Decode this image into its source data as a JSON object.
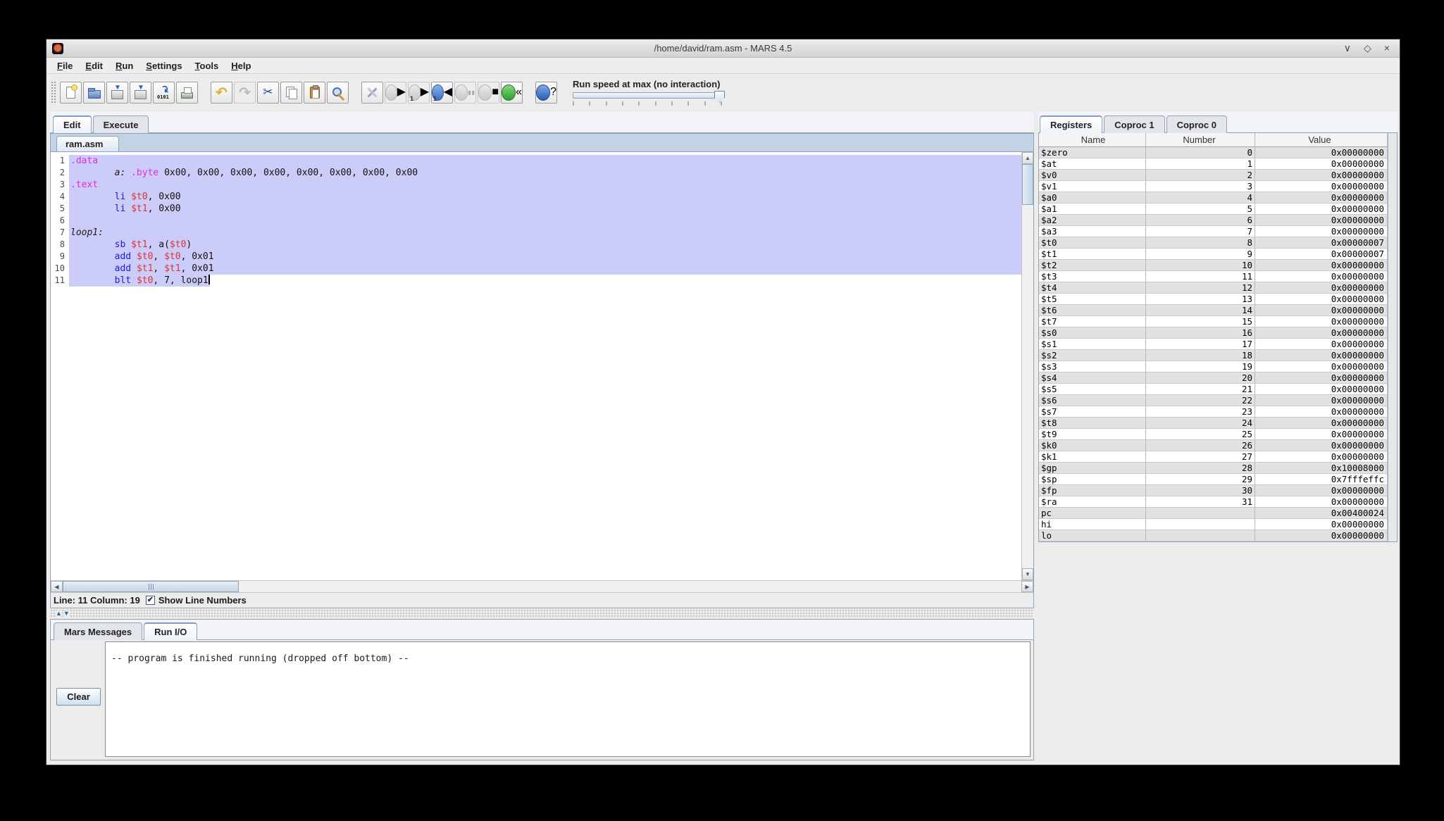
{
  "window": {
    "title": "/home/david/ram.asm - MARS 4.5",
    "controls": {
      "minimize": "∨",
      "maximize": "◇",
      "close": "×"
    }
  },
  "colors": {
    "selection": "#ccccf9",
    "directive": "#e02ce0",
    "instruction": "#1a1ae0",
    "register": "#dd3333"
  },
  "menu": {
    "items": [
      {
        "id": "file",
        "m": "F",
        "rest": "ile"
      },
      {
        "id": "edit",
        "m": "E",
        "rest": "dit"
      },
      {
        "id": "run",
        "m": "R",
        "rest": "un"
      },
      {
        "id": "settings",
        "m": "S",
        "rest": "ettings"
      },
      {
        "id": "tools",
        "m": "T",
        "rest": "ools"
      },
      {
        "id": "help",
        "m": "H",
        "rest": "elp"
      }
    ]
  },
  "toolbar": {
    "speed_label": "Run speed at max (no interaction)",
    "tick_count": 10,
    "buttons": [
      {
        "type": "grip",
        "name": "toolbar-grip"
      },
      {
        "type": "btn",
        "name": "new-file-button",
        "icon": "new-file-icon",
        "shape": "i-page i-new",
        "glyph": "",
        "enabled": true
      },
      {
        "type": "btn",
        "name": "open-file-button",
        "icon": "open-folder-icon",
        "shape": "i-folder",
        "glyph": "",
        "enabled": true
      },
      {
        "type": "btn",
        "name": "save-button",
        "icon": "save-icon",
        "shape": "i-save",
        "glyph": "▼",
        "gcls": "save-arrow",
        "enabled": true
      },
      {
        "type": "btn",
        "name": "save-as-button",
        "icon": "save-as-icon",
        "shape": "i-save",
        "glyph": "▼",
        "gcls": "save-arrow",
        "enabled": true
      },
      {
        "type": "btn",
        "name": "dump-memory-button",
        "icon": "dump-binary-icon",
        "shape": "i-dump",
        "glyph": "0101",
        "gcls": "dump-text",
        "enabled": true
      },
      {
        "type": "btn",
        "name": "print-button",
        "icon": "printer-icon",
        "shape": "i-print",
        "glyph": "",
        "enabled": true
      },
      {
        "type": "sep"
      },
      {
        "type": "btn",
        "name": "undo-button",
        "icon": "undo-arrow-icon",
        "glyph": "↶",
        "gcls": "g-undo",
        "enabled": true
      },
      {
        "type": "btn",
        "name": "redo-button",
        "icon": "redo-arrow-icon",
        "glyph": "↷",
        "gcls": "g-redo",
        "enabled": false
      },
      {
        "type": "btn",
        "name": "cut-button",
        "icon": "scissors-icon",
        "glyph": "✂",
        "gcls": "g-cut",
        "enabled": true
      },
      {
        "type": "btn",
        "name": "copy-button",
        "icon": "copy-pages-icon",
        "shape": "i-copy",
        "glyph": "",
        "enabled": true
      },
      {
        "type": "btn",
        "name": "paste-button",
        "icon": "clipboard-icon",
        "shape": "i-paste",
        "glyph": "",
        "enabled": true
      },
      {
        "type": "btn",
        "name": "find-replace-button",
        "icon": "magnifier-pencil-icon",
        "shape": "i-find",
        "glyph": "",
        "enabled": true
      },
      {
        "type": "sep"
      },
      {
        "type": "btn",
        "name": "assemble-button",
        "icon": "crossed-tools-icon",
        "shape": "i-tools",
        "glyph": "",
        "enabled": true
      },
      {
        "type": "btn",
        "name": "run-button",
        "icon": "play-circle-icon",
        "shape": "i-circle c-gray",
        "glyph": "▶",
        "enabled": false
      },
      {
        "type": "btn",
        "name": "step-forward-button",
        "icon": "step-forward-circle-icon",
        "shape": "i-circle c-gray",
        "glyph": "▶",
        "sub": "1",
        "enabled": false
      },
      {
        "type": "btn",
        "name": "step-backward-button",
        "icon": "step-backward-circle-icon",
        "shape": "i-circle c-blue",
        "glyph": "◀",
        "sub": "1",
        "enabled": true
      },
      {
        "type": "btn",
        "name": "pause-button",
        "icon": "pause-circle-icon",
        "shape": "i-circle c-gray",
        "glyph": "▮▮",
        "gcls": "g-pause",
        "enabled": false
      },
      {
        "type": "btn",
        "name": "stop-button",
        "icon": "stop-circle-icon",
        "shape": "i-circle c-gray",
        "glyph": "■",
        "enabled": false
      },
      {
        "type": "btn",
        "name": "reset-button",
        "icon": "reset-circle-icon",
        "shape": "i-circle c-green",
        "glyph": "«",
        "enabled": true
      },
      {
        "type": "sep"
      },
      {
        "type": "btn",
        "name": "help-button",
        "icon": "help-circle-icon",
        "shape": "i-circle c-helpblue",
        "glyph": "?",
        "enabled": true
      }
    ]
  },
  "tabs": {
    "edit": "Edit",
    "execute": "Execute",
    "file_tab": "ram.asm"
  },
  "editor": {
    "lines": [
      {
        "num": "1",
        "hl": "full",
        "segs": [
          {
            "s": "dir",
            "t": ".data"
          }
        ]
      },
      {
        "num": "2",
        "hl": "full",
        "segs": [
          {
            "s": "plain",
            "t": "        "
          },
          {
            "s": "label",
            "t": "a:"
          },
          {
            "s": "plain",
            "t": " "
          },
          {
            "s": "dir",
            "t": ".byte"
          },
          {
            "s": "plain",
            "t": " 0x00, 0x00, 0x00, 0x00, 0x00, 0x00, 0x00, 0x00"
          }
        ]
      },
      {
        "num": "3",
        "hl": "full",
        "segs": [
          {
            "s": "dir",
            "t": ".text"
          }
        ]
      },
      {
        "num": "4",
        "hl": "full",
        "segs": [
          {
            "s": "plain",
            "t": "        "
          },
          {
            "s": "instr",
            "t": "li"
          },
          {
            "s": "plain",
            "t": " "
          },
          {
            "s": "reg",
            "t": "$t0"
          },
          {
            "s": "plain",
            "t": ", 0x00"
          }
        ]
      },
      {
        "num": "5",
        "hl": "full",
        "segs": [
          {
            "s": "plain",
            "t": "        "
          },
          {
            "s": "instr",
            "t": "li"
          },
          {
            "s": "plain",
            "t": " "
          },
          {
            "s": "reg",
            "t": "$t1"
          },
          {
            "s": "plain",
            "t": ", 0x00"
          }
        ]
      },
      {
        "num": "6",
        "hl": "full",
        "segs": []
      },
      {
        "num": "7",
        "hl": "full",
        "segs": [
          {
            "s": "label",
            "t": "loop1:"
          }
        ]
      },
      {
        "num": "8",
        "hl": "full",
        "segs": [
          {
            "s": "plain",
            "t": "        "
          },
          {
            "s": "instr",
            "t": "sb"
          },
          {
            "s": "plain",
            "t": " "
          },
          {
            "s": "reg",
            "t": "$t1"
          },
          {
            "s": "plain",
            "t": ", a("
          },
          {
            "s": "reg",
            "t": "$t0"
          },
          {
            "s": "plain",
            "t": ")"
          }
        ]
      },
      {
        "num": "9",
        "hl": "full",
        "segs": [
          {
            "s": "plain",
            "t": "        "
          },
          {
            "s": "instr",
            "t": "add"
          },
          {
            "s": "plain",
            "t": " "
          },
          {
            "s": "reg",
            "t": "$t0"
          },
          {
            "s": "plain",
            "t": ", "
          },
          {
            "s": "reg",
            "t": "$t0"
          },
          {
            "s": "plain",
            "t": ", 0x01"
          }
        ]
      },
      {
        "num": "10",
        "hl": "full",
        "segs": [
          {
            "s": "plain",
            "t": "        "
          },
          {
            "s": "instr",
            "t": "add"
          },
          {
            "s": "plain",
            "t": " "
          },
          {
            "s": "reg",
            "t": "$t1"
          },
          {
            "s": "plain",
            "t": ", "
          },
          {
            "s": "reg",
            "t": "$t1"
          },
          {
            "s": "plain",
            "t": ", 0x01"
          }
        ]
      },
      {
        "num": "11",
        "hl": "text",
        "cursor": true,
        "segs": [
          {
            "s": "plain",
            "t": "        "
          },
          {
            "s": "instr",
            "t": "blt"
          },
          {
            "s": "plain",
            "t": " "
          },
          {
            "s": "reg",
            "t": "$t0"
          },
          {
            "s": "plain",
            "t": ", 7, loop1"
          }
        ]
      }
    ],
    "status": {
      "line_col": "Line: 11 Column: 19",
      "checkbox_checked": "✔",
      "show_line_numbers": "Show Line Numbers"
    }
  },
  "messages": {
    "tabs": {
      "mars": "Mars Messages",
      "runio": "Run I/O"
    },
    "clear_label": "Clear",
    "run_io_text": "-- program is finished running (dropped off bottom) --"
  },
  "registers": {
    "tabs": [
      "Registers",
      "Coproc 1",
      "Coproc 0"
    ],
    "columns": [
      "Name",
      "Number",
      "Value"
    ],
    "rows": [
      [
        "$zero",
        "0",
        "0x00000000"
      ],
      [
        "$at",
        "1",
        "0x00000000"
      ],
      [
        "$v0",
        "2",
        "0x00000000"
      ],
      [
        "$v1",
        "3",
        "0x00000000"
      ],
      [
        "$a0",
        "4",
        "0x00000000"
      ],
      [
        "$a1",
        "5",
        "0x00000000"
      ],
      [
        "$a2",
        "6",
        "0x00000000"
      ],
      [
        "$a3",
        "7",
        "0x00000000"
      ],
      [
        "$t0",
        "8",
        "0x00000007"
      ],
      [
        "$t1",
        "9",
        "0x00000007"
      ],
      [
        "$t2",
        "10",
        "0x00000000"
      ],
      [
        "$t3",
        "11",
        "0x00000000"
      ],
      [
        "$t4",
        "12",
        "0x00000000"
      ],
      [
        "$t5",
        "13",
        "0x00000000"
      ],
      [
        "$t6",
        "14",
        "0x00000000"
      ],
      [
        "$t7",
        "15",
        "0x00000000"
      ],
      [
        "$s0",
        "16",
        "0x00000000"
      ],
      [
        "$s1",
        "17",
        "0x00000000"
      ],
      [
        "$s2",
        "18",
        "0x00000000"
      ],
      [
        "$s3",
        "19",
        "0x00000000"
      ],
      [
        "$s4",
        "20",
        "0x00000000"
      ],
      [
        "$s5",
        "21",
        "0x00000000"
      ],
      [
        "$s6",
        "22",
        "0x00000000"
      ],
      [
        "$s7",
        "23",
        "0x00000000"
      ],
      [
        "$t8",
        "24",
        "0x00000000"
      ],
      [
        "$t9",
        "25",
        "0x00000000"
      ],
      [
        "$k0",
        "26",
        "0x00000000"
      ],
      [
        "$k1",
        "27",
        "0x00000000"
      ],
      [
        "$gp",
        "28",
        "0x10008000"
      ],
      [
        "$sp",
        "29",
        "0x7fffeffc"
      ],
      [
        "$fp",
        "30",
        "0x00000000"
      ],
      [
        "$ra",
        "31",
        "0x00000000"
      ],
      [
        "pc",
        "",
        "0x00400024"
      ],
      [
        "hi",
        "",
        "0x00000000"
      ],
      [
        "lo",
        "",
        "0x00000000"
      ]
    ]
  }
}
